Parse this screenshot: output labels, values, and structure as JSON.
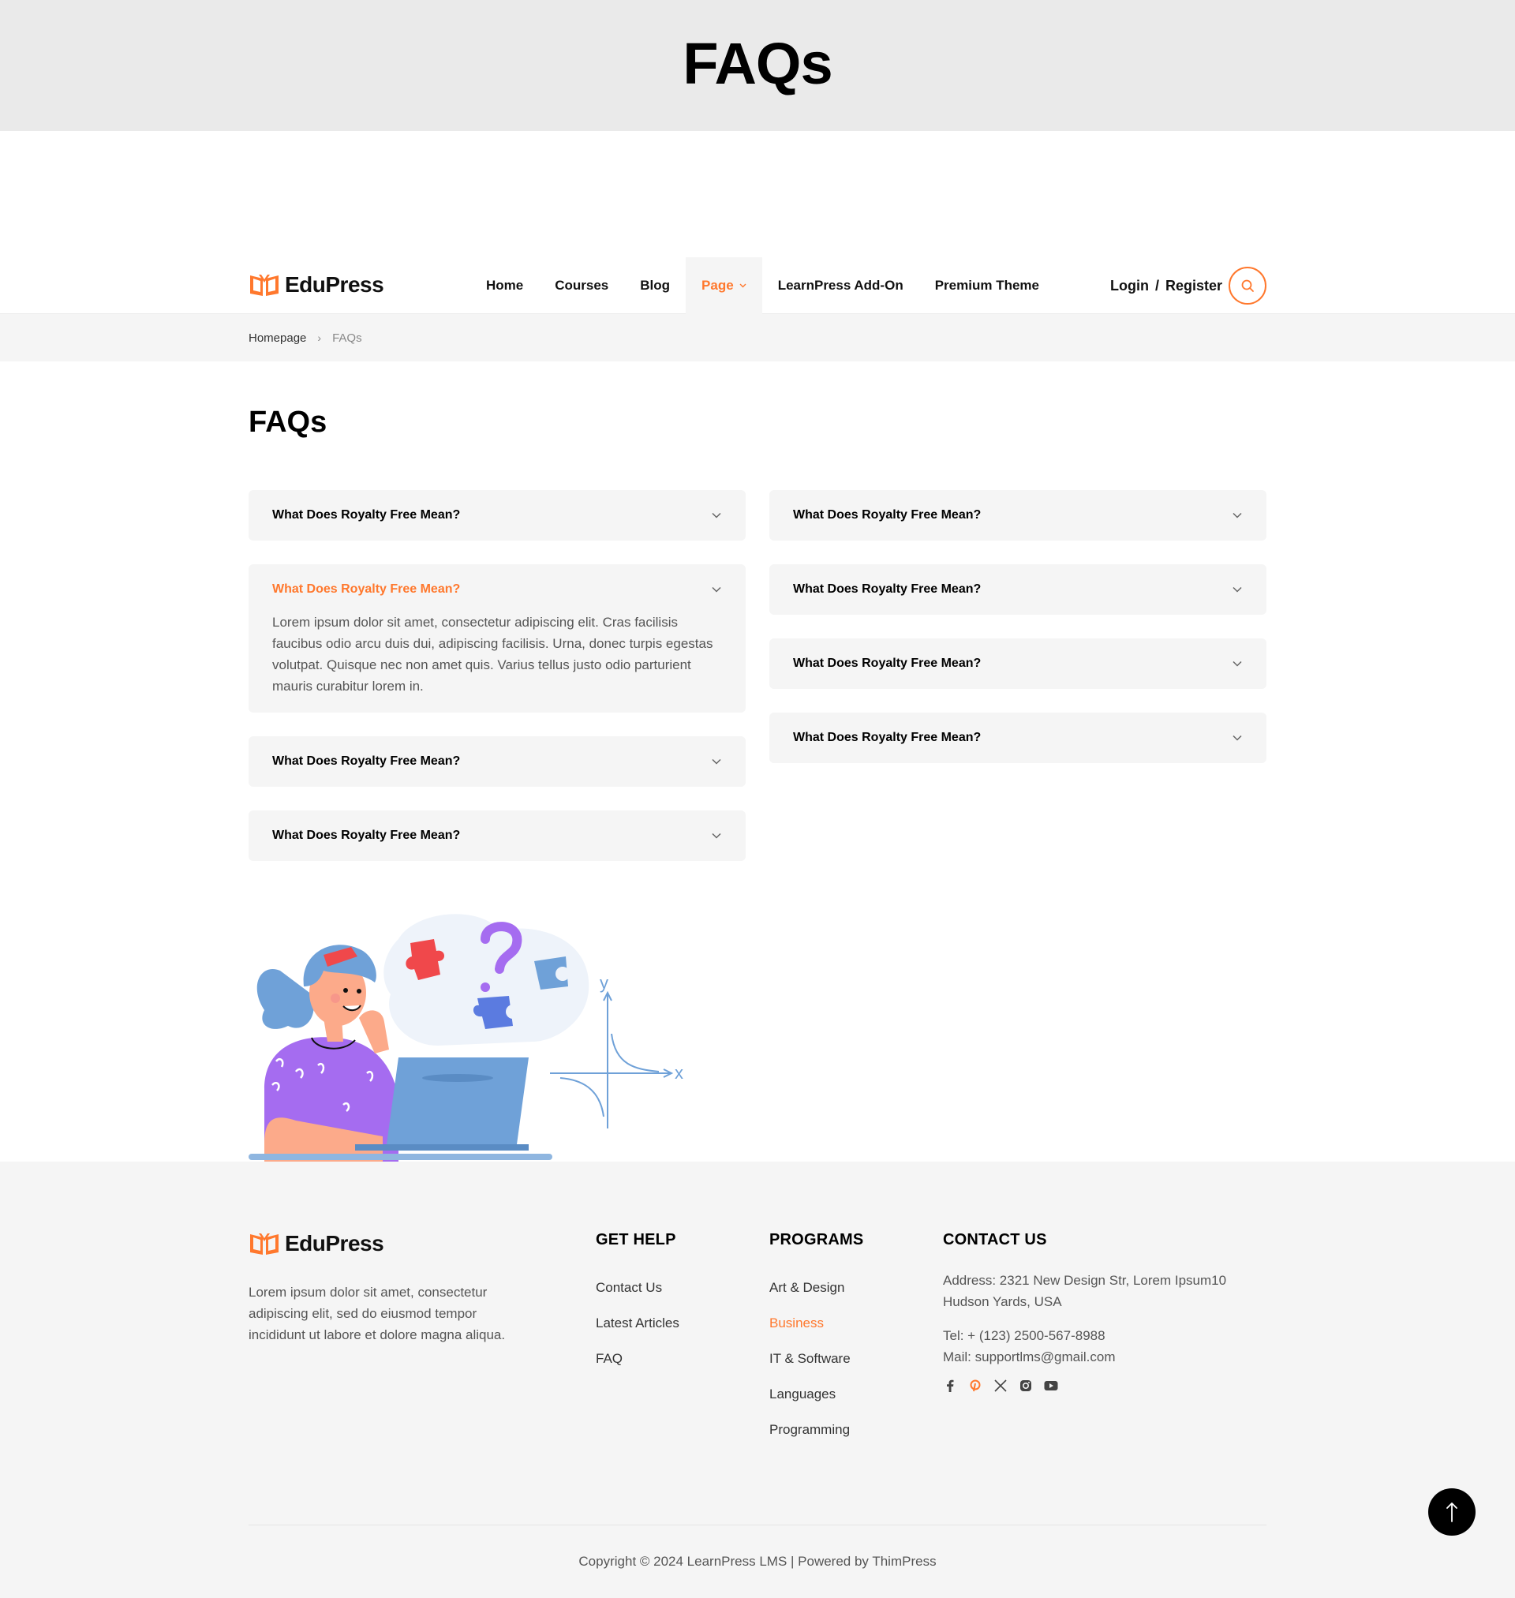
{
  "banner": {
    "title": "FAQs"
  },
  "brand": {
    "name": "EduPress",
    "accent_color": "#ff782d"
  },
  "nav": {
    "items": [
      {
        "label": "Home"
      },
      {
        "label": "Courses"
      },
      {
        "label": "Blog"
      },
      {
        "label": "Page",
        "active": true,
        "has_dropdown": true
      },
      {
        "label": "LearnPress Add-On"
      },
      {
        "label": "Premium Theme"
      }
    ],
    "login_label": "Login",
    "separator": "/",
    "register_label": "Register",
    "search_icon": "search-icon"
  },
  "breadcrumb": {
    "home": "Homepage",
    "separator": "›",
    "current": "FAQs"
  },
  "main": {
    "title": "FAQs",
    "faq_left": [
      {
        "question": "What Does Royalty Free Mean?",
        "open": false
      },
      {
        "question": "What Does Royalty Free Mean?",
        "open": true,
        "answer": "Lorem ipsum dolor sit amet, consectetur adipiscing elit. Cras facilisis faucibus odio arcu duis dui, adipiscing facilisis. Urna, donec turpis egestas volutpat. Quisque nec non amet quis. Varius tellus justo odio parturient mauris curabitur lorem in."
      },
      {
        "question": "What Does Royalty Free Mean?",
        "open": false
      },
      {
        "question": "What Does Royalty Free Mean?",
        "open": false
      }
    ],
    "faq_right": [
      {
        "question": "What Does Royalty Free Mean?",
        "open": false
      },
      {
        "question": "What Does Royalty Free Mean?",
        "open": false
      },
      {
        "question": "What Does Royalty Free Mean?",
        "open": false
      },
      {
        "question": "What Does Royalty Free Mean?",
        "open": false
      }
    ],
    "illustration": {
      "graph_y_label": "y",
      "graph_x_label": "x"
    }
  },
  "footer": {
    "description": "Lorem ipsum dolor sit amet, consectetur adipiscing elit, sed do eiusmod tempor incididunt ut labore et dolore magna aliqua.",
    "get_help": {
      "title": "GET HELP",
      "links": [
        "Contact Us",
        "Latest Articles",
        "FAQ"
      ]
    },
    "programs": {
      "title": "PROGRAMS",
      "links": [
        "Art & Design",
        "Business",
        "IT & Software",
        "Languages",
        "Programming"
      ],
      "highlighted_index": 1
    },
    "contact": {
      "title": "CONTACT US",
      "address": "Address: 2321 New Design Str, Lorem Ipsum10 Hudson Yards, USA",
      "tel": "Tel: + (123) 2500-567-8988",
      "mail": "Mail: supportlms@gmail.com",
      "socials": [
        "facebook-icon",
        "pinterest-icon",
        "x-icon",
        "instagram-icon",
        "youtube-icon"
      ]
    },
    "copyright": "Copyright © 2024 LearnPress LMS | Powered by ThimPress"
  },
  "back_to_top_icon": "arrow-up-icon"
}
